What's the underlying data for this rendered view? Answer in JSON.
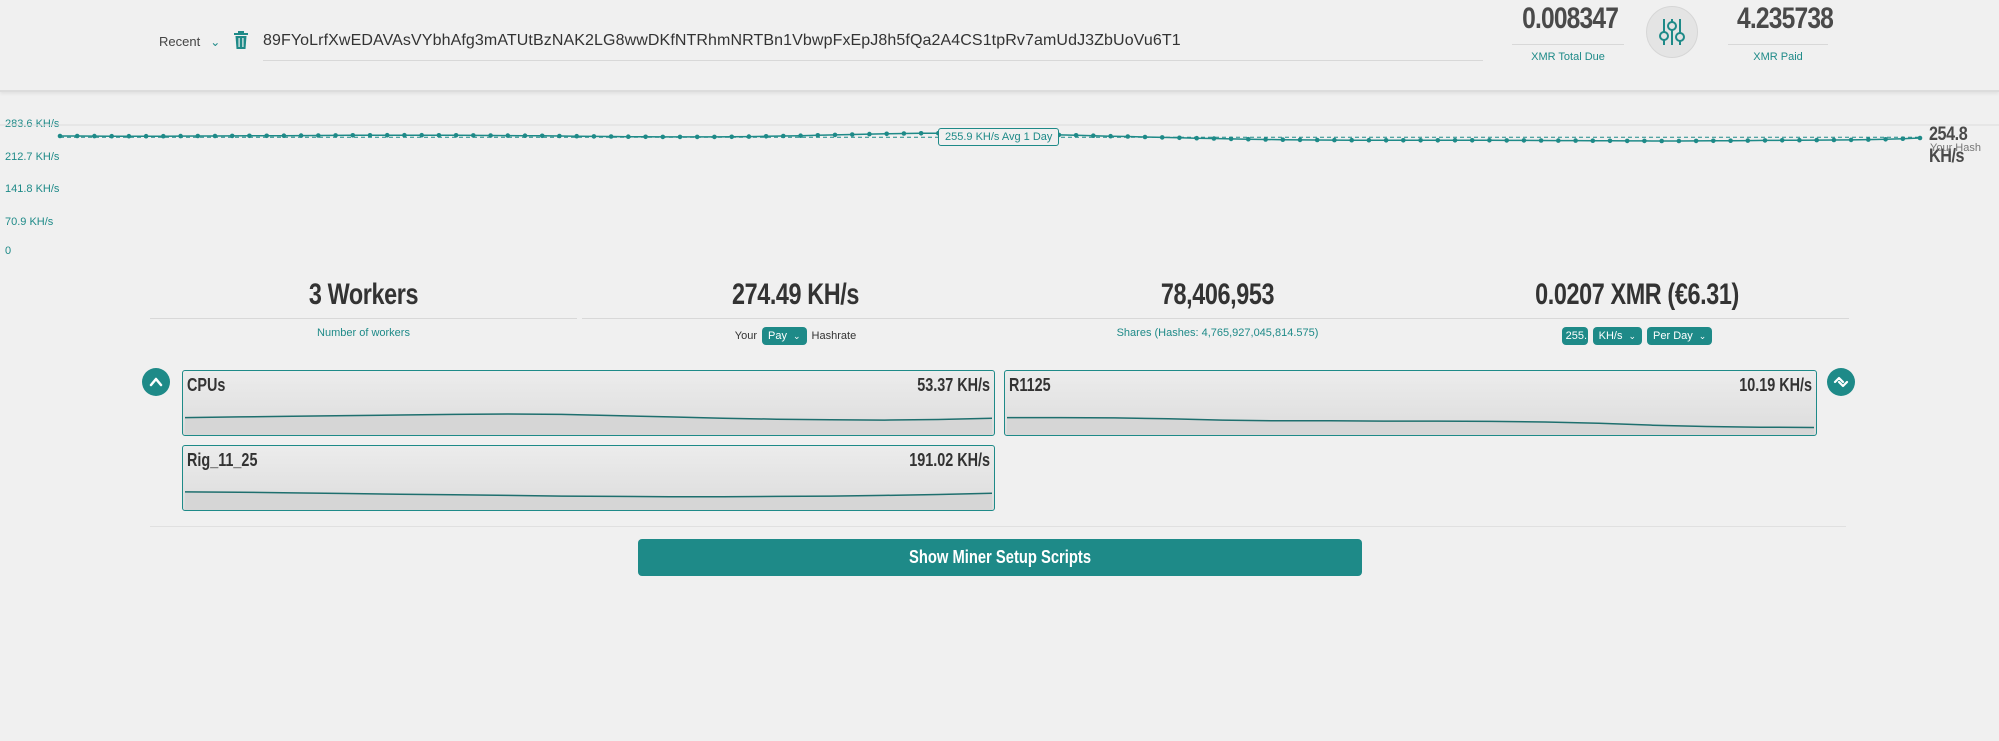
{
  "header": {
    "recent_label": "Recent",
    "address": "89FYoLrfXwEDAVAsVYbhAfg3mATUtBzNAK2LG8wwDKfNTRhmNRTBn1VbwpFxEpJ8h5fQa2A4CS1tpRv7amUdJ3ZbUoVu6T1",
    "total_due_value": "0.008347",
    "total_due_label": "XMR Total Due",
    "paid_value": "4.235738",
    "paid_label": "XMR Paid"
  },
  "chart": {
    "y_ticks": [
      "283.6 KH/s",
      "212.7 KH/s",
      "141.8 KH/s",
      "70.9 KH/s",
      "0"
    ],
    "avg_label": "255.9 KH/s Avg 1 Day",
    "avg_value": 255.9,
    "current_value": "254.8 KH/s",
    "current_label": "Your Hash"
  },
  "chart_data": {
    "type": "line",
    "ylim": [
      0,
      283.6
    ],
    "series": [
      {
        "values": [
          258.6,
          258.6,
          258.4,
          258.3,
          258.3,
          258.2,
          258.3,
          258.4,
          258.6,
          258.7,
          258.9,
          259.0,
          259.2,
          259.4,
          259.6,
          259.8,
          260.0,
          260.2,
          260.3,
          260.4,
          260.4,
          260.4,
          260.3,
          260.2,
          260.0,
          259.8,
          259.6,
          259.3,
          259.0,
          258.6,
          258.2,
          257.8,
          257.4,
          257.1,
          256.8,
          256.6,
          256.5,
          256.5,
          256.6,
          256.9,
          257.3,
          257.9,
          258.6,
          259.4,
          260.3,
          261.2,
          262.1,
          263.0,
          263.7,
          264.3,
          264.8,
          265.0,
          265.0,
          264.7,
          264.2,
          263.6,
          262.8,
          262.0,
          261.1,
          260.2,
          259.3,
          258.3,
          257.4,
          256.4,
          255.5,
          254.6,
          253.7,
          252.9,
          252.1,
          251.4,
          250.8,
          250.3,
          249.9,
          249.6,
          249.4,
          249.2,
          249.1,
          249.0,
          249.0,
          249.0,
          249.0,
          248.9,
          248.8,
          248.8,
          248.7,
          248.6,
          248.5,
          248.3,
          248.1,
          247.9,
          247.7,
          247.6,
          247.5,
          247.4,
          247.4,
          247.5,
          247.7,
          247.9,
          248.2,
          248.6,
          248.9,
          249.2,
          249.4,
          249.6,
          249.9,
          250.4,
          251.2,
          252.5,
          254.2
        ]
      }
    ]
  },
  "summary": {
    "workers_value": "3 Workers",
    "workers_label": "Number of workers",
    "hashrate_value": "274.49 KH/s",
    "hashrate_prefix": "Your",
    "hashrate_mode": "Pay",
    "hashrate_suffix": "Hashrate",
    "shares_value": "78,406,953",
    "shares_label": "Shares (Hashes: 4,765,927,045,814.575)",
    "earn_value": "0.0207 XMR (€6.31)",
    "earn_input": "255.",
    "earn_unit": "KH/s",
    "earn_period": "Per Day"
  },
  "workers": [
    {
      "name": "CPUs",
      "rate": "53.37 KH/s",
      "trend": [
        0.42,
        0.44,
        0.46,
        0.48,
        0.5,
        0.52,
        0.53,
        0.52,
        0.48,
        0.44,
        0.4,
        0.37,
        0.35,
        0.34,
        0.36,
        0.4
      ]
    },
    {
      "name": "R1125",
      "rate": "10.19 KH/s",
      "trend": [
        0.42,
        0.42,
        0.41,
        0.38,
        0.34,
        0.32,
        0.32,
        0.31,
        0.31,
        0.3,
        0.28,
        0.24,
        0.18,
        0.14,
        0.12,
        0.11
      ]
    },
    {
      "name": "Rig_11_25",
      "rate": "191.02 KH/s",
      "trend": [
        0.44,
        0.43,
        0.41,
        0.39,
        0.37,
        0.35,
        0.33,
        0.31,
        0.3,
        0.29,
        0.29,
        0.3,
        0.31,
        0.33,
        0.36,
        0.4
      ]
    }
  ],
  "actions": {
    "setup_label": "Show Miner Setup Scripts"
  },
  "colors": {
    "accent": "#1e8a88",
    "background": "#f0f0f0"
  }
}
